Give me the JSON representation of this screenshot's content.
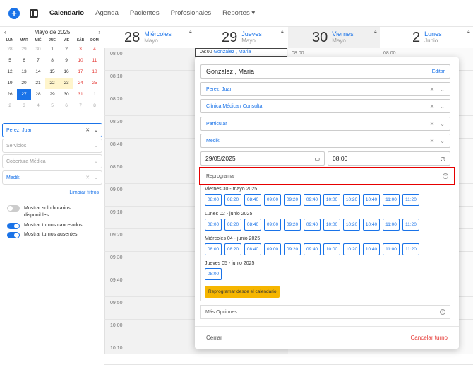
{
  "nav": {
    "items": [
      "Calendario",
      "Agenda",
      "Pacientes",
      "Profesionales",
      "Reportes ▾"
    ],
    "active": "Calendario"
  },
  "mini_calendar": {
    "prev": "‹",
    "title": "Mayo de 2025",
    "next": "›",
    "dows": [
      "LUN",
      "MAR",
      "MIÉ",
      "JUE",
      "VIE",
      "SÁB",
      "DOM"
    ],
    "weeks": [
      [
        "28",
        "29",
        "30",
        "1",
        "2",
        "3",
        "4"
      ],
      [
        "5",
        "6",
        "7",
        "8",
        "9",
        "10",
        "11"
      ],
      [
        "12",
        "13",
        "14",
        "15",
        "16",
        "17",
        "18"
      ],
      [
        "19",
        "20",
        "21",
        "22",
        "23",
        "24",
        "25"
      ],
      [
        "26",
        "27",
        "28",
        "29",
        "30",
        "31",
        "1"
      ],
      [
        "2",
        "3",
        "4",
        "5",
        "6",
        "7",
        "8"
      ]
    ]
  },
  "filters": {
    "professional": "Perez, Juan",
    "services": "Servicios",
    "coverage": "Cobertura Médica",
    "plan": "Mediki",
    "clear": "Limpiar filtros"
  },
  "toggles": [
    {
      "label": "Mostrar solo horarios disponibles",
      "on": false
    },
    {
      "label": "Mostrar turnos cancelados",
      "on": true
    },
    {
      "label": "Mostrar turnos ausentes",
      "on": true
    }
  ],
  "days": [
    {
      "num": "28",
      "name": "Miércoles",
      "month": "Mayo"
    },
    {
      "num": "29",
      "name": "Jueves",
      "month": "Mayo"
    },
    {
      "num": "30",
      "name": "Viernes",
      "month": "Mayo"
    },
    {
      "num": "2",
      "name": "Lunes",
      "month": "Junio"
    }
  ],
  "times": [
    "08:00",
    "08:10",
    "08:20",
    "08:30",
    "08:40",
    "08:50",
    "09:00",
    "09:10",
    "09:20",
    "09:30",
    "09:40",
    "09:50",
    "10:00",
    "10:10"
  ],
  "col_times": {
    "col1": "08:00",
    "col2": "08:00"
  },
  "event": {
    "time": "08:00",
    "patient": "Gonzalez , Maria"
  },
  "popup": {
    "patient": "Gonzalez , Maria",
    "edit": "Editar",
    "professional": "Perez, Juan",
    "service": "Clínica Médica / Consulta",
    "type": "Particular",
    "plan": "Mediki",
    "date": "29/05/2025",
    "time": "08:00",
    "reprogram": "Reprogramar",
    "reschedule_days": [
      {
        "label": "Viernes 30 - mayo 2025",
        "slots": [
          "08:00",
          "08:20",
          "08:40",
          "09:00",
          "09:20",
          "09:40",
          "10:00",
          "10:20",
          "10:40",
          "11:00",
          "11:20"
        ]
      },
      {
        "label": "Lunes 02 - junio 2025",
        "slots": [
          "08:00",
          "08:20",
          "08:40",
          "09:00",
          "09:20",
          "09:40",
          "10:00",
          "10:20",
          "10:40",
          "11:00",
          "11:20"
        ]
      },
      {
        "label": "Miércoles 04 - junio 2025",
        "slots": [
          "08:00",
          "08:20",
          "08:40",
          "09:00",
          "09:20",
          "09:40",
          "10:00",
          "10:20",
          "10:40",
          "11:00",
          "11:20"
        ]
      },
      {
        "label": "Jueves 05 - junio 2025",
        "slots": [
          "08:00"
        ]
      }
    ],
    "calendar_button": "Reprogramar desde el calendario",
    "more_options": "Más Opciones",
    "close": "Cerrar",
    "cancel": "Cancelar turno"
  },
  "colors": {
    "accent": "#1a73e8",
    "danger": "#e53935",
    "warning": "#f6b600"
  }
}
